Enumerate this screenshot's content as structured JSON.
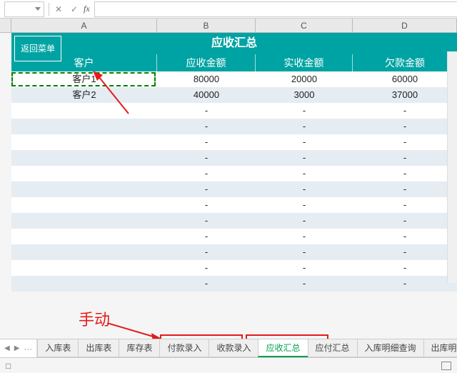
{
  "formula_bar": {
    "name_box": "",
    "fx_label": "fx",
    "formula": ""
  },
  "columns": [
    "A",
    "B",
    "C",
    "D"
  ],
  "title": "应收汇总",
  "return_button": "返回菜单",
  "headers": [
    "客户",
    "应收金额",
    "实收金额",
    "欠款金额"
  ],
  "rows": [
    {
      "customer": "客户1",
      "receivable": "80000",
      "received": "20000",
      "owed": "60000"
    },
    {
      "customer": "客户2",
      "receivable": "40000",
      "received": "3000",
      "owed": "37000"
    },
    {
      "customer": "",
      "receivable": "-",
      "received": "-",
      "owed": "-"
    },
    {
      "customer": "",
      "receivable": "-",
      "received": "-",
      "owed": "-"
    },
    {
      "customer": "",
      "receivable": "-",
      "received": "-",
      "owed": "-"
    },
    {
      "customer": "",
      "receivable": "-",
      "received": "-",
      "owed": "-"
    },
    {
      "customer": "",
      "receivable": "-",
      "received": "-",
      "owed": "-"
    },
    {
      "customer": "",
      "receivable": "-",
      "received": "-",
      "owed": "-"
    },
    {
      "customer": "",
      "receivable": "-",
      "received": "-",
      "owed": "-"
    },
    {
      "customer": "",
      "receivable": "-",
      "received": "-",
      "owed": "-"
    },
    {
      "customer": "",
      "receivable": "-",
      "received": "-",
      "owed": "-"
    },
    {
      "customer": "",
      "receivable": "-",
      "received": "-",
      "owed": "-"
    },
    {
      "customer": "",
      "receivable": "-",
      "received": "-",
      "owed": "-"
    },
    {
      "customer": "",
      "receivable": "-",
      "received": "-",
      "owed": "-"
    }
  ],
  "annotation": "手动",
  "tabs_nav_dots": "···",
  "tabs": [
    {
      "label": "入库表",
      "active": false
    },
    {
      "label": "出库表",
      "active": false
    },
    {
      "label": "库存表",
      "active": false
    },
    {
      "label": "付款录入",
      "active": false
    },
    {
      "label": "收款录入",
      "active": false
    },
    {
      "label": "应收汇总",
      "active": true
    },
    {
      "label": "应付汇总",
      "active": false
    },
    {
      "label": "入库明细查询",
      "active": false
    },
    {
      "label": "出库明",
      "active": false
    }
  ],
  "status": {
    "left_icon": "□"
  }
}
